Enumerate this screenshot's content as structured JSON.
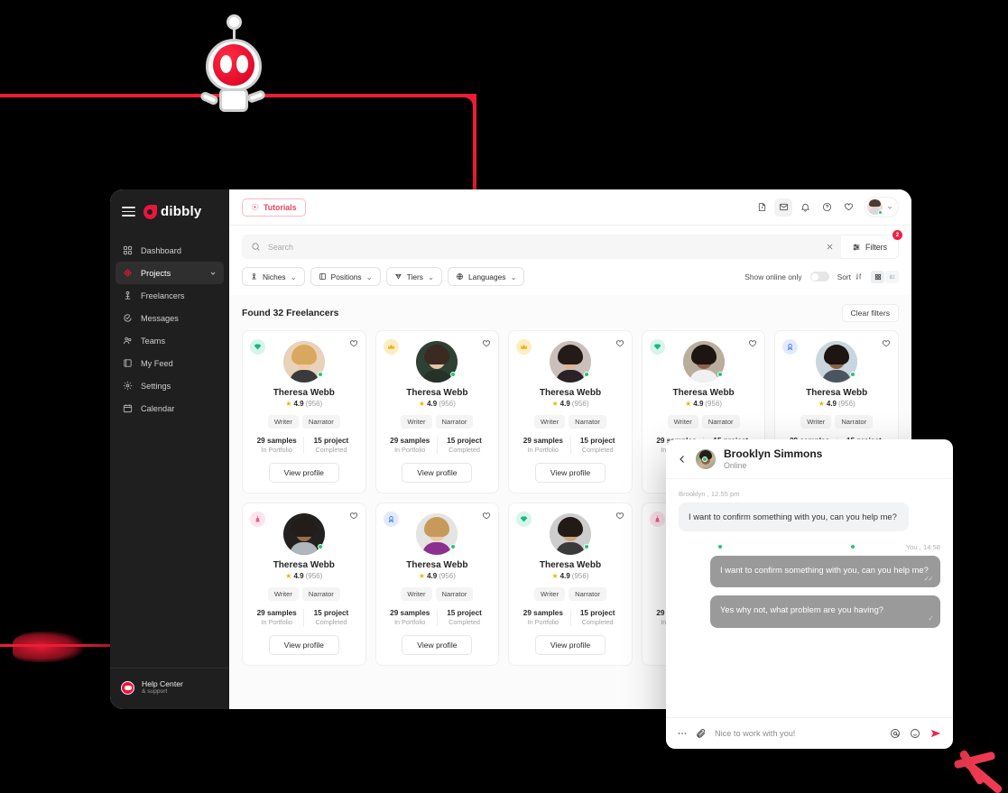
{
  "brand": {
    "name": "dibbly",
    "logo_color": "#e8173d"
  },
  "sidebar": {
    "items": [
      {
        "label": "Dashboard",
        "icon": "dashboard-icon",
        "active": false
      },
      {
        "label": "Projects",
        "icon": "projects-icon",
        "active": true,
        "chevron": true
      },
      {
        "label": "Freelancers",
        "icon": "freelancers-icon",
        "active": false
      },
      {
        "label": "Messages",
        "icon": "messages-icon",
        "active": false
      },
      {
        "label": "Teams",
        "icon": "teams-icon",
        "active": false
      },
      {
        "label": "My Feed",
        "icon": "feed-icon",
        "active": false
      },
      {
        "label": "Settings",
        "icon": "settings-icon",
        "active": false
      },
      {
        "label": "Calendar",
        "icon": "calendar-icon",
        "active": false
      }
    ],
    "help": {
      "title": "Help Center",
      "subtitle": "& support"
    }
  },
  "topbar": {
    "tutorials_label": "Tutorials",
    "icons": [
      "file-icon",
      "mail-icon",
      "bell-icon",
      "help-circle-icon",
      "heart-icon"
    ]
  },
  "search": {
    "placeholder": "Search",
    "value": "",
    "filters_label": "Filters",
    "filters_badge": "2"
  },
  "chips": [
    {
      "label": "Niches",
      "icon": "niches-icon"
    },
    {
      "label": "Positions",
      "icon": "positions-icon"
    },
    {
      "label": "Tiers",
      "icon": "tiers-icon"
    },
    {
      "label": "Languages",
      "icon": "languages-icon"
    }
  ],
  "controls": {
    "online_only_label": "Show online only",
    "online_only_on": false,
    "sort_label": "Sort",
    "view_grid_active": true
  },
  "results": {
    "found_label": "Found 32 Freelancers",
    "clear_filters_label": "Clear filters",
    "card_defaults": {
      "name": "Theresa Webb",
      "rating": "4.9",
      "reviews": "(956)",
      "tags": [
        "Writer",
        "Narrator"
      ],
      "stat1_value": "29 samples",
      "stat1_label": "In Portfolio",
      "stat2_value": "15 project",
      "stat2_label": "Completed",
      "cta": "View profile"
    },
    "cards": [
      {
        "badge": "diamond-icon",
        "badge_color": "teal",
        "avatar": "blonde-woman"
      },
      {
        "badge": "crown-icon",
        "badge_color": "gold",
        "avatar": "brunette-woman"
      },
      {
        "badge": "crown-icon",
        "badge_color": "gold",
        "avatar": "dark-hair-woman"
      },
      {
        "badge": "diamond-icon",
        "badge_color": "teal",
        "avatar": "bearded-man"
      },
      {
        "badge": "ribbon-icon",
        "badge_color": "blue",
        "avatar": "suit-man"
      },
      {
        "badge": "tower-icon",
        "badge_color": "rose",
        "avatar": "glasses-man"
      },
      {
        "badge": "ribbon-icon",
        "badge_color": "blue",
        "avatar": "curly-woman"
      },
      {
        "badge": "diamond-icon",
        "badge_color": "teal",
        "avatar": "short-hair-man"
      },
      {
        "badge": "tower-icon",
        "badge_color": "rose",
        "avatar": "hidden-person"
      },
      {
        "badge": "diamond-icon",
        "badge_color": "teal",
        "avatar": "hidden-person"
      }
    ]
  },
  "chat": {
    "contact_name": "Brooklyn Simmons",
    "contact_status": "Online",
    "messages": [
      {
        "meta": "Brooklyn , 12.55 pm",
        "text": "I want to confirm something with you, can you help me?",
        "side": "them",
        "ticks": ""
      },
      {
        "meta": "You , 14:58",
        "text": "I want to confirm something with you, can you help me?",
        "side": "me",
        "ticks": "✓✓"
      },
      {
        "meta": "",
        "text": "Yes why not, what problem are you having?",
        "side": "me",
        "ticks": "✓"
      }
    ],
    "input_placeholder": "Nice to work with you!",
    "input_value": ""
  },
  "decor": {
    "mascot": "robot-mascot",
    "accent_red": "#ee1c35"
  }
}
